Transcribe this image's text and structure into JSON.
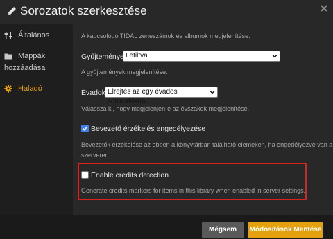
{
  "header": {
    "title": "Sorozatok szerkesztése"
  },
  "sidebar": {
    "items": [
      {
        "label": "Általános",
        "icon": "sliders-icon"
      },
      {
        "label": "Mappák",
        "label2": "hozzáadása",
        "icon": "folder-icon"
      },
      {
        "label": "Haladó",
        "icon": "gear-icon",
        "active": true
      }
    ]
  },
  "content": {
    "intro": "A kapcsolódó TIDAL zeneszámok és albumok megjelenítése.",
    "collections_label": "Gyűjtemények",
    "collections_value": "Letiltva",
    "collections_help": "A gyűjtemények megjelenítése.",
    "seasons_label": "Évadok",
    "seasons_value": "Elrejtés az egy évados sorozatoknál",
    "seasons_help": "Válassza ki, hogy megjelenjen-e az évszakok megjelenítése.",
    "intro_detect_label": "Bevezető érzékelés engedélyezése",
    "intro_detect_checked": true,
    "intro_detect_help_1": "Bevezetők érzékelése az ebben a könyvtárban található elemeken, ha engedélyezve van a",
    "intro_detect_help_2": "szerveren.",
    "credits_label": "Enable credits detection",
    "credits_checked": false,
    "credits_help": "Generate credits markers for items in this library when enabled in server settings."
  },
  "footer": {
    "cancel_label": "Mégsem",
    "save_label": "Módosítások Mentése"
  },
  "colors": {
    "accent": "#e5a00d",
    "checkbox": "#3d7ff2",
    "highlight_box": "#d9241d"
  }
}
